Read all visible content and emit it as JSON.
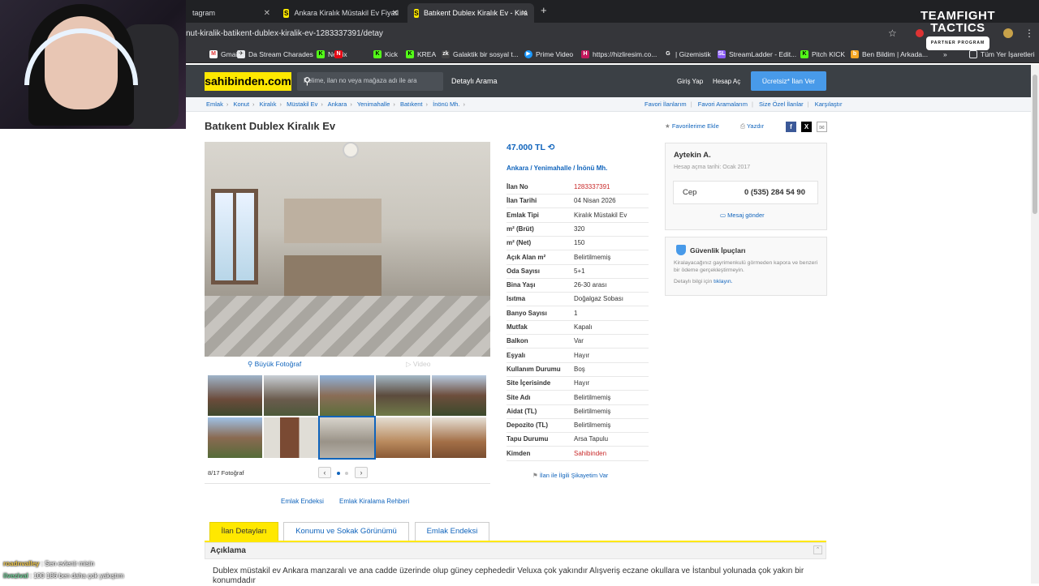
{
  "browser": {
    "tabs": [
      {
        "label": "tagram"
      },
      {
        "label": "Ankara Kiralık Müstakil Ev Fiyatl"
      },
      {
        "label": "Batıkent Dublex Kiralık Ev - Kira"
      }
    ],
    "url": "nut-kiralik-batikent-dublex-kiralik-ev-1283337391/detay",
    "bookmarks": [
      "Gmail",
      "Da Stream Charades",
      "Netflix",
      "Kick",
      "KREA",
      "Galaktik bir sosyal t...",
      "Prime Video",
      "https://hizliresim.co...",
      "| Gizemistik",
      "StreamLadder - Edit...",
      "Pitch KICK",
      "Ben Bildim | Arkada...",
      "Tüm Yer İşaretleri"
    ]
  },
  "overlay": {
    "tft_line1": "TEAMFIGHT",
    "tft_line2": "TACTICS",
    "tft_badge": "PARTNER PROGRAM",
    "chat": [
      {
        "user": "roadnvalley",
        "text": "Sen evlenir misin"
      },
      {
        "user": "ilvezival",
        "text": "100 186 ben daha çok yakıştım"
      }
    ]
  },
  "site": {
    "logo": "sahibinden.com",
    "search_placeholder": "Kelime, ilan no veya mağaza adı ile ara",
    "detailed_search": "Detaylı Arama",
    "login": "Giriş Yap",
    "register": "Hesap Aç",
    "post_ad": "Ücretsiz* İlan Ver",
    "breadcrumbs": [
      "Emlak",
      "Konut",
      "Kiralık",
      "Müstakil Ev",
      "Ankara",
      "Yenimahalle",
      "Batıkent",
      "İnönü Mh."
    ],
    "right_links": [
      "Favori İlanlarım",
      "Favori Aramalarım",
      "Size Özel İlanlar",
      "Karşılaştır"
    ]
  },
  "listing": {
    "title": "Batıkent Dublex Kiralık Ev",
    "add_favorite": "Favorilerime Ekle",
    "print": "Yazdır",
    "price": "47.000 TL",
    "location": [
      "Ankara",
      "Yenimahalle",
      "İnönü Mh."
    ],
    "big_photo": "Büyük Fotoğraf",
    "video": "Video",
    "photo_count": "8/17 Fotoğraf",
    "details": [
      {
        "k": "İlan No",
        "v": "1283337391"
      },
      {
        "k": "İlan Tarihi",
        "v": "04 Nisan 2026"
      },
      {
        "k": "Emlak Tipi",
        "v": "Kiralık Müstakil Ev"
      },
      {
        "k": "m² (Brüt)",
        "v": "320"
      },
      {
        "k": "m² (Net)",
        "v": "150"
      },
      {
        "k": "Açık Alan m²",
        "v": "Belirtilmemiş"
      },
      {
        "k": "Oda Sayısı",
        "v": "5+1"
      },
      {
        "k": "Bina Yaşı",
        "v": "26-30 arası"
      },
      {
        "k": "Isıtma",
        "v": "Doğalgaz Sobası"
      },
      {
        "k": "Banyo Sayısı",
        "v": "1"
      },
      {
        "k": "Mutfak",
        "v": "Kapalı"
      },
      {
        "k": "Balkon",
        "v": "Var"
      },
      {
        "k": "Eşyalı",
        "v": "Hayır"
      },
      {
        "k": "Kullanım Durumu",
        "v": "Boş"
      },
      {
        "k": "Site İçerisinde",
        "v": "Hayır"
      },
      {
        "k": "Site Adı",
        "v": "Belirtilmemiş"
      },
      {
        "k": "Aidat (TL)",
        "v": "Belirtilmemiş"
      },
      {
        "k": "Depozito (TL)",
        "v": "Belirtilmemiş"
      },
      {
        "k": "Tapu Durumu",
        "v": "Arsa Tapulu"
      },
      {
        "k": "Kimden",
        "v": "Sahibinden"
      }
    ],
    "complaint": "İlan ile İlgili Şikayetim Var",
    "seller": {
      "name": "Aytekin A.",
      "since": "Hesap açma tarihi: Ocak 2017",
      "phone_label": "Cep",
      "phone": "0 (535) 284 54 90",
      "message": "Mesaj gönder"
    },
    "safety": {
      "title": "Güvenlik İpuçları",
      "text": "Kiralayacağınız gayrimenkulü görmeden kapora ve benzeri bir ödeme gerçekleştirmeyin.",
      "link_prefix": "Detaylı bilgi için",
      "link": "tıklayın."
    },
    "links": [
      "Emlak Endeksi",
      "Emlak Kiralama Rehberi"
    ],
    "tabs": [
      "İlan Detayları",
      "Konumu ve Sokak Görünümü",
      "Emlak Endeksi"
    ],
    "section_title": "Açıklama",
    "description": "Dublex müstakil ev Ankara manzaralı ve ana cadde üzerinde olup güney cephededir Veluxa çok yakındır Alışveriş eczane okullara ve İstanbul yolunada çok yakın bir konumdadır"
  },
  "colors": {
    "brand_yellow": "#ffe800",
    "header": "#3b4045",
    "link": "#1064bc",
    "cta": "#489ae9"
  }
}
